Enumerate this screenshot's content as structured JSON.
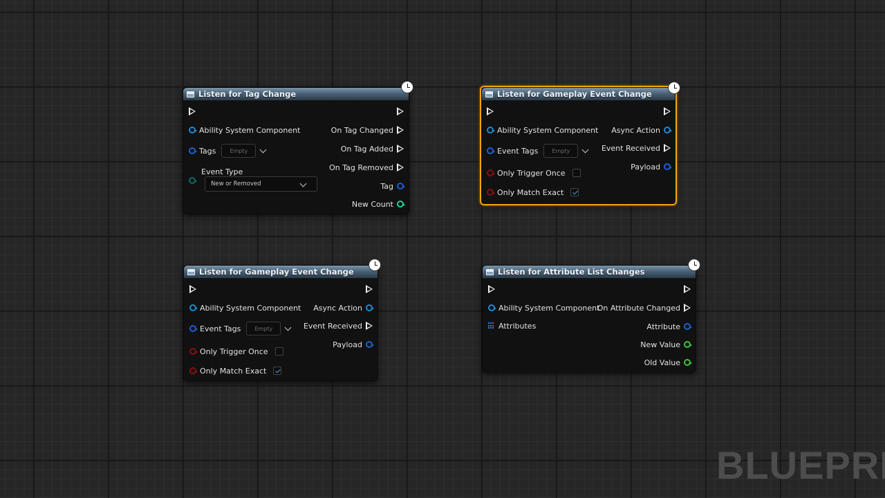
{
  "nodes": {
    "tag_change": {
      "title": "Listen for Tag Change",
      "inputs": {
        "asc": "Ability System Component",
        "tags": "Tags",
        "tags_value": "Empty",
        "event_type": "Event Type",
        "event_type_value": "New or Removed"
      },
      "outputs": {
        "on_tag_changed": "On Tag Changed",
        "on_tag_added": "On Tag Added",
        "on_tag_removed": "On Tag Removed",
        "tag": "Tag",
        "new_count": "New Count"
      }
    },
    "gameplay_event_selected": {
      "title": "Listen for Gameplay Event Change",
      "inputs": {
        "asc": "Ability System Component",
        "event_tags": "Event Tags",
        "event_tags_value": "Empty",
        "only_trigger_once": "Only Trigger Once",
        "only_trigger_once_checked": false,
        "only_match_exact": "Only Match Exact",
        "only_match_exact_checked": true
      },
      "outputs": {
        "async_action": "Async Action",
        "event_received": "Event Received",
        "payload": "Payload"
      }
    },
    "gameplay_event": {
      "title": "Listen for Gameplay Event Change",
      "inputs": {
        "asc": "Ability System Component",
        "event_tags": "Event Tags",
        "event_tags_value": "Empty",
        "only_trigger_once": "Only Trigger Once",
        "only_trigger_once_checked": false,
        "only_match_exact": "Only Match Exact",
        "only_match_exact_checked": true
      },
      "outputs": {
        "async_action": "Async Action",
        "event_received": "Event Received",
        "payload": "Payload"
      }
    },
    "attribute_list": {
      "title": "Listen for Attribute List Changes",
      "inputs": {
        "asc": "Ability System Component",
        "attributes": "Attributes"
      },
      "outputs": {
        "on_attribute_changed": "On Attribute Changed",
        "attribute": "Attribute",
        "new_value": "New Value",
        "old_value": "Old Value"
      }
    }
  },
  "watermark": "BLUEPRIN",
  "colors": {
    "selection": "#f7a40d",
    "object_pin": "#1d8bd6",
    "bool_pin": "#8a0f0f",
    "float_pin": "#3ec43e"
  }
}
